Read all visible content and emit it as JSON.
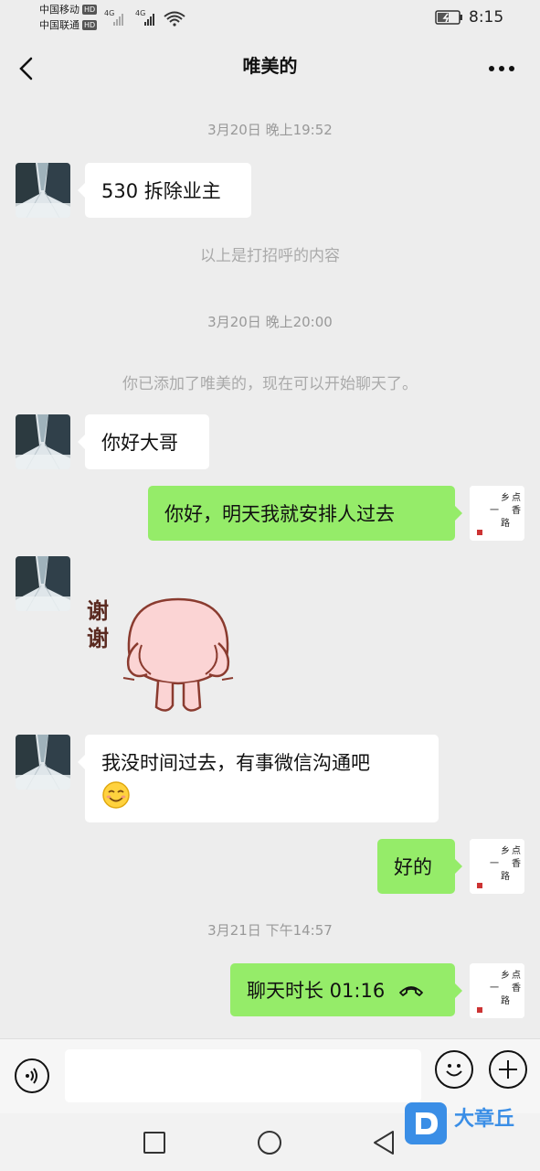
{
  "status_bar": {
    "carrier1": "中国移动",
    "carrier2": "中国联通",
    "hd": "HD",
    "net1": "4G",
    "net2": "4G",
    "time": "8:15"
  },
  "header": {
    "title": "唯美的"
  },
  "messages": {
    "ts1": "3月20日 晚上19:52",
    "m1": "530 拆除业主",
    "sys1": "以上是打招呼的内容",
    "ts2": "3月20日 晚上20:00",
    "sys2": "你已添加了唯美的，现在可以开始聊天了。",
    "m2": "你好大哥",
    "m3": "你好，明天我就安排人过去",
    "sticker_text": "谢谢",
    "m5_line1": "我没时间过去，有事微信沟通吧",
    "m6": "好的",
    "ts3": "3月21日 下午14:57",
    "m7": "聊天时长 01:16"
  },
  "watermark": {
    "text": "大章丘"
  },
  "my_avatar_glyphs": "乡一点香路",
  "colors": {
    "background": "#ededed",
    "incoming_bubble": "#ffffff",
    "outgoing_bubble": "#95ec69",
    "timestamp": "#999999",
    "watermark_blue": "#3a8ee6"
  },
  "icons": [
    "back-arrow-icon",
    "more-icon",
    "voice-icon",
    "emoji-icon",
    "plus-icon",
    "phone-icon",
    "square-nav-icon",
    "circle-nav-icon",
    "triangle-nav-icon"
  ]
}
